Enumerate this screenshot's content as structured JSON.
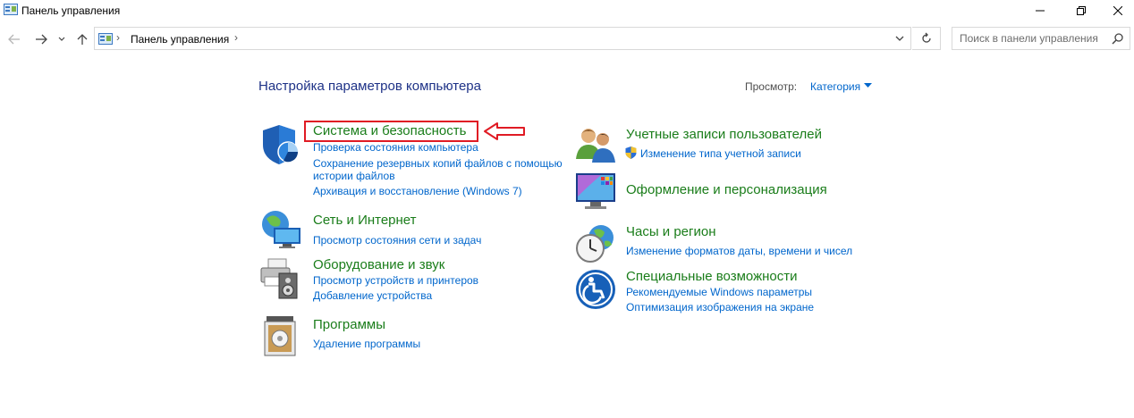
{
  "window": {
    "title": "Панель управления"
  },
  "address_bar": {
    "breadcrumb": "Панель управления",
    "search_placeholder": "Поиск в панели управления"
  },
  "content": {
    "heading": "Настройка параметров компьютера",
    "view_label": "Просмотр:",
    "view_value": "Категория"
  },
  "categories": [
    {
      "title": "Система и безопасность",
      "icon": "shield-icon",
      "links": [
        "Проверка состояния компьютера",
        "Сохранение резервных копий файлов с помощью",
        "истории файлов",
        "Архивация и восстановление (Windows 7)"
      ]
    },
    {
      "title": "Сеть и Интернет",
      "icon": "network-globe-icon",
      "links": [
        "Просмотр состояния сети и задач"
      ]
    },
    {
      "title": "Оборудование и звук",
      "icon": "printer-speaker-icon",
      "links": [
        "Просмотр устройств и принтеров",
        "Добавление устройства"
      ]
    },
    {
      "title": "Программы",
      "icon": "programs-icon",
      "links": [
        "Удаление программы"
      ]
    },
    {
      "title": "Учетные записи пользователей",
      "icon": "users-icon",
      "links": [
        "Изменение типа учетной записи"
      ]
    },
    {
      "title": "Оформление и персонализация",
      "icon": "appearance-icon",
      "links": []
    },
    {
      "title": "Часы и регион",
      "icon": "clock-globe-icon",
      "links": [
        "Изменение форматов даты, времени и чисел"
      ]
    },
    {
      "title": "Специальные возможности",
      "icon": "accessibility-icon",
      "links": [
        "Рекомендуемые Windows параметры",
        "Оптимизация изображения на экране"
      ]
    }
  ],
  "colors": {
    "heading": "#1e3287",
    "category_title": "#1a7d1a",
    "link": "#0066cc",
    "highlight": "#e01b24"
  }
}
